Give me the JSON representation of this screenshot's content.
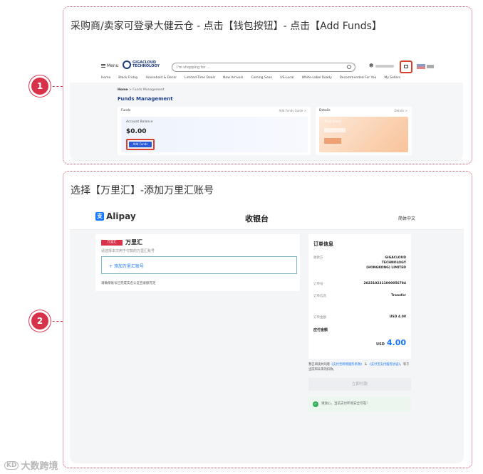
{
  "step1": {
    "number": "1",
    "title": "采购商/卖家可登录大健云仓 - 点击【钱包按钮】- 点击【Add Funds】",
    "screenshot": {
      "menu_label": "Menu",
      "logo_text_1": "GIGACLOUD",
      "logo_text_2": "TECHNOLOGY",
      "search_placeholder": "I'm shopping for ...",
      "nav": [
        "Home",
        "Black Friday",
        "Household & Decor",
        "Limited-Time Deals",
        "New Arrivals",
        "Coming Soon",
        "US-Local",
        "White-Label Ready",
        "Recommended For You",
        "My Sellers"
      ],
      "breadcrumb_home": "Home",
      "breadcrumb_current": "Funds Management",
      "page_title": "Funds Management",
      "funds_header": "Funds",
      "funds_guide": "Add Funds Guide >",
      "account_balance_label": "Account Balance",
      "account_balance_value": "$0.00",
      "add_funds_button": "Add Funds",
      "details_header": "Details",
      "details_more": "Details >",
      "total_debit_label": "Total Debit"
    }
  },
  "step2": {
    "number": "2",
    "title": "选择【万里汇】-添加万里汇账号",
    "screenshot": {
      "logo_text": "Alipay",
      "page_title": "收银台",
      "language": "简体中文",
      "wl_badge": "万里汇 WorldFirst",
      "wl_title": "万里汇",
      "wl_desc": "请选择本次用于付款的万里汇账号",
      "add_account": "+ 添加万里汇账号",
      "note": "请确保账号已完成实名认证且录额充足",
      "order_info_title": "订单信息",
      "rows": [
        {
          "label": "收款方",
          "value": "GIGACLOUD TECHNOLOGY (HONGKONG) LIMITED"
        },
        {
          "label": "订单号",
          "value": "2023102311090056784"
        },
        {
          "label": "订单信息",
          "value": "Transfer"
        },
        {
          "label": "订单金额",
          "value": "USD 4.00"
        }
      ],
      "pay_amount_label": "应付金额",
      "pay_currency": "USD",
      "pay_amount": "4.00",
      "agreement_prefix": "我已阅读并同意",
      "agreement_link1": "《支付宝跨境服务条款》",
      "agreement_and": "&",
      "agreement_link2": "《支付宝支付服务协议》",
      "agreement_suffix": "，等于当前和未来的扣款。",
      "pay_button": "立即付款",
      "safe_note": "请放心，当前支付环境安全可靠！"
    }
  },
  "watermark": "大数跨境"
}
